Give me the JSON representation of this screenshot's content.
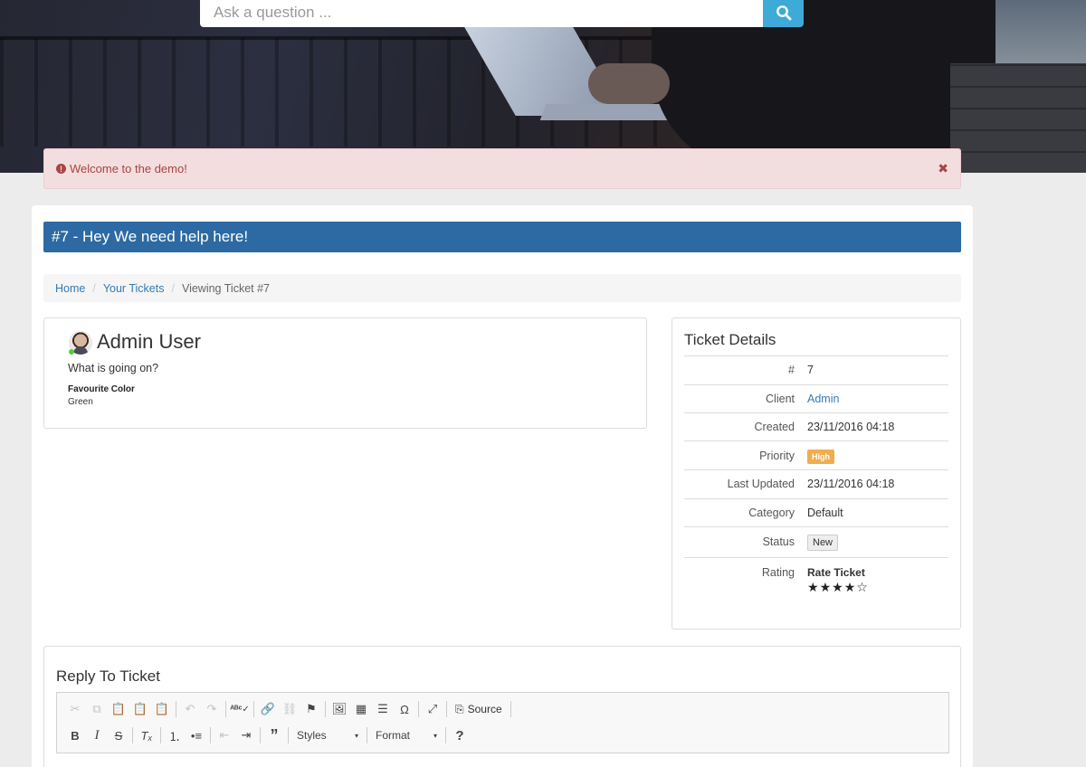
{
  "search": {
    "placeholder": "Ask a question ..."
  },
  "alert": {
    "message": "Welcome to the demo!",
    "close_symbol": "✖"
  },
  "ticket": {
    "title": "#7 - Hey We need help here!"
  },
  "breadcrumb": {
    "items": [
      "Home",
      "Your Tickets"
    ],
    "current": "Viewing Ticket #7",
    "separator": "/"
  },
  "message": {
    "author": "Admin User",
    "text": "What is going on?",
    "field_label": "Favourite Color",
    "field_value": "Green"
  },
  "details": {
    "heading": "Ticket Details",
    "rows": [
      {
        "key": "#",
        "value": "7"
      },
      {
        "key": "Client",
        "value": "Admin"
      },
      {
        "key": "Created",
        "value": "23/11/2016 04:18"
      },
      {
        "key": "Priority",
        "value": "High"
      },
      {
        "key": "Last Updated",
        "value": "23/11/2016 04:18"
      },
      {
        "key": "Category",
        "value": "Default"
      },
      {
        "key": "Status",
        "value": "New"
      },
      {
        "key": "Rating",
        "value": "Rate Ticket"
      }
    ],
    "rating": {
      "filled": 4,
      "total": 5,
      "filled_symbol": "★",
      "empty_symbol": "☆"
    }
  },
  "reply": {
    "heading": "Reply To Ticket",
    "toolbar": {
      "source_label": "Source",
      "styles_label": "Styles",
      "format_label": "Format",
      "help_label": "?",
      "caret": "▾"
    }
  },
  "colors": {
    "title_bar": "#2d6aa3",
    "search_button": "#3eaad7",
    "alert_bg": "#f2dede",
    "alert_text": "#a94442",
    "priority_high": "#f0ad4e",
    "link": "#337ab7"
  }
}
